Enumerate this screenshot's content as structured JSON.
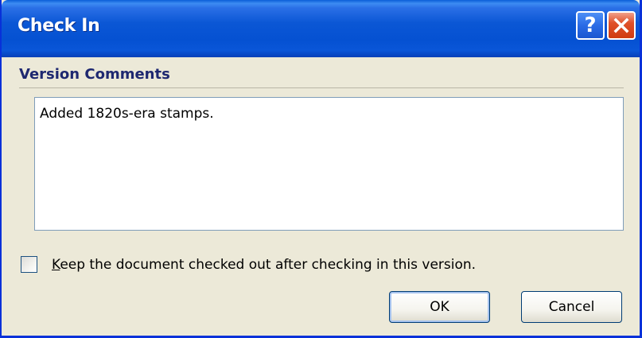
{
  "window": {
    "title": "Check In",
    "help_label": "?",
    "close_icon": "close-icon"
  },
  "section": {
    "title": "Version Comments"
  },
  "comments": {
    "value": "Added 1820s-era stamps."
  },
  "checkbox": {
    "first_letter": "K",
    "rest": "eep the document checked out after checking in this version.",
    "checked": false
  },
  "buttons": {
    "ok": "OK",
    "cancel": "Cancel"
  },
  "colors": {
    "titlebar": "#0551d2",
    "dialog_bg": "#ece9d8",
    "close_button": "#e0512a",
    "section_title": "#1e2870"
  }
}
